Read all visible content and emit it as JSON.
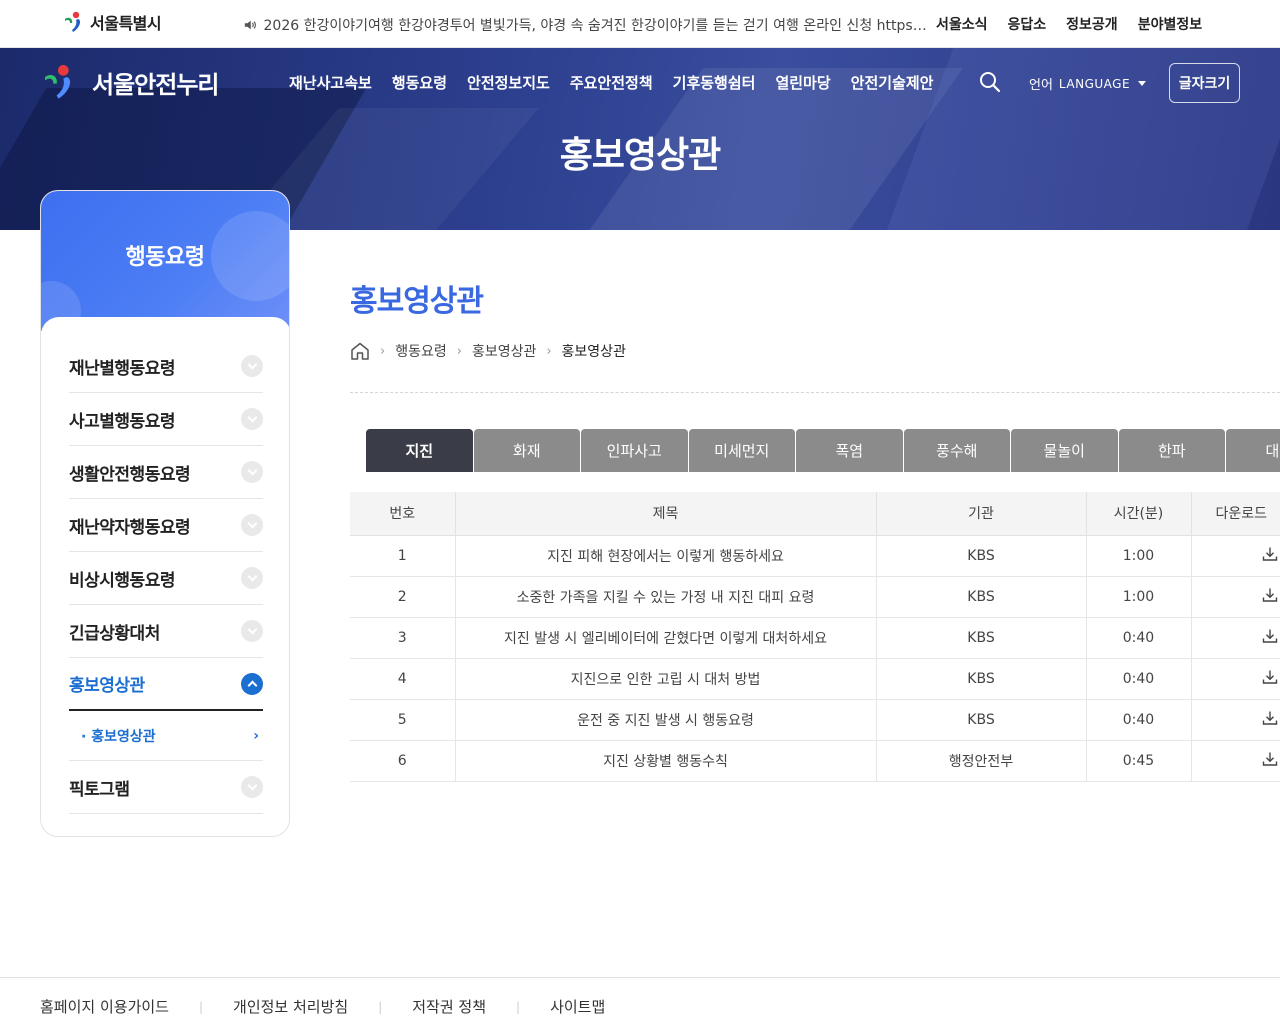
{
  "topbar": {
    "logo_text": "서울특별시",
    "notice": "2026 한강이야기여행 한강야경투어 별빛가득, 야경 속 숨겨진 한강이야기를 듣는 걷기 여행 온라인 신청 https://yeyak.seoul.go.kr",
    "links": [
      "서울소식",
      "응답소",
      "정보공개",
      "분야별정보"
    ]
  },
  "header": {
    "site_name": "서울안전누리",
    "gnb": [
      "재난사고속보",
      "행동요령",
      "안전정보지도",
      "주요안전정책",
      "기후동행쉼터",
      "열린마당",
      "안전기술제안"
    ],
    "lang_ko": "언어",
    "lang_en": "LANGUAGE",
    "fontsize_label": "글자크기",
    "page_title": "홍보영상관"
  },
  "sidebar": {
    "title": "행동요령",
    "items": [
      {
        "label": "재난별행동요령"
      },
      {
        "label": "사고별행동요령"
      },
      {
        "label": "생활안전행동요령"
      },
      {
        "label": "재난약자행동요령"
      },
      {
        "label": "비상시행동요령"
      },
      {
        "label": "긴급상황대처"
      },
      {
        "label": "홍보영상관"
      },
      {
        "label": "픽토그램"
      }
    ],
    "sub_item": "· 홍보영상관"
  },
  "content": {
    "title": "홍보영상관",
    "breadcrumb": [
      "행동요령",
      "홍보영상관",
      "홍보영상관"
    ],
    "tabs": [
      "지진",
      "화재",
      "인파사고",
      "미세먼지",
      "폭염",
      "풍수해",
      "물놀이",
      "한파",
      "대설"
    ],
    "table": {
      "headers": [
        "번호",
        "제목",
        "기관",
        "시간(분)",
        "다운로드"
      ],
      "rows": [
        [
          "1",
          "지진 피해 현장에서는 이렇게 행동하세요",
          "KBS",
          "1:00"
        ],
        [
          "2",
          "소중한 가족을 지킬 수 있는 가정 내 지진 대피 요령",
          "KBS",
          "1:00"
        ],
        [
          "3",
          "지진 발생 시 엘리베이터에 갇혔다면 이렇게 대처하세요",
          "KBS",
          "0:40"
        ],
        [
          "4",
          "지진으로 인한 고립 시 대처 방법",
          "KBS",
          "0:40"
        ],
        [
          "5",
          "운전 중 지진 발생 시 행동요령",
          "KBS",
          "0:40"
        ],
        [
          "6",
          "지진 상황별 행동수칙",
          "행정안전부",
          "0:45"
        ]
      ]
    }
  },
  "footer": {
    "links": [
      "홈페이지 이용가이드",
      "개인정보 처리방침",
      "저작권 정책",
      "사이트맵"
    ]
  },
  "colors": {
    "accent": "#3a68e0",
    "active_blue": "#1b6fd0",
    "tab_active": "#3a3d47",
    "tab_inactive": "#8b8b8b"
  }
}
